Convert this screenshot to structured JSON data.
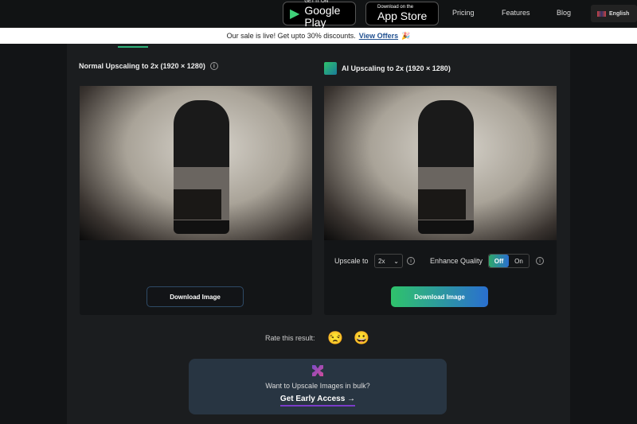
{
  "header": {
    "google_play": {
      "small": "GET IT ON",
      "large": "Google Play"
    },
    "app_store": {
      "small": "Download on the",
      "large": "App Store"
    },
    "nav": [
      "Pricing",
      "Features",
      "Blog"
    ],
    "language": "English"
  },
  "banner": {
    "text": "Our sale is live! Get upto 30% discounts.",
    "link": "View Offers",
    "emoji": "🎉"
  },
  "left_panel": {
    "title": "Normal Upscaling to 2x (1920 × 1280)",
    "download": "Download Image"
  },
  "right_panel": {
    "title": "AI Upscaling to 2x (1920 × 1280)",
    "upscale_label": "Upscale to",
    "upscale_value": "2x",
    "enhance_label": "Enhance Quality",
    "toggle_off": "Off",
    "toggle_on": "On",
    "toggle_selected": "Off",
    "download": "Download Image"
  },
  "rating": {
    "label": "Rate this result:",
    "bad": "😒",
    "good": "😀"
  },
  "cta": {
    "question": "Want to Upscale Images in bulk?",
    "link": "Get Early Access →"
  },
  "colors": {
    "accent_green": "#2fc36b",
    "accent_blue": "#2a6fd0",
    "link_blue": "#1f4f8f"
  }
}
